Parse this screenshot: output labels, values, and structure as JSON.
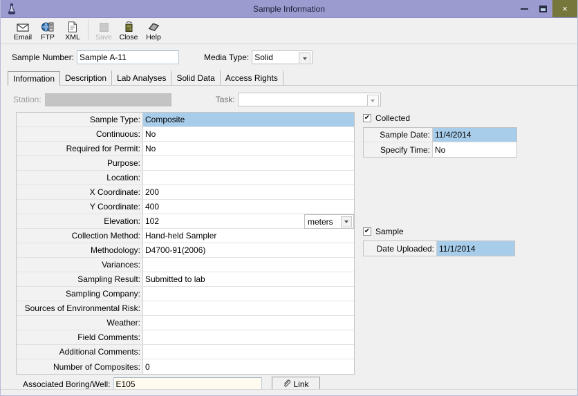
{
  "window": {
    "title": "Sample Information",
    "icon": "flask-icon",
    "buttons": {
      "minimize": "minimize-icon",
      "maximize": "maximize-icon",
      "close": "×"
    },
    "colors": {
      "titlebar": "#9c9bd0",
      "close_button": "#76773a",
      "selection": "#a8cdea",
      "surface": "#f0f0f0",
      "ivory_field": "#fffbee"
    }
  },
  "toolbar": {
    "items": [
      {
        "label": "Email",
        "icon": "envelope-icon",
        "disabled": false
      },
      {
        "label": "FTP",
        "icon": "ftp-globe-icon",
        "disabled": false
      },
      {
        "label": "XML",
        "icon": "xml-document-icon",
        "disabled": false
      },
      {
        "label": "Save",
        "icon": "save-disk-icon",
        "disabled": true
      },
      {
        "label": "Close",
        "icon": "door-close-icon",
        "disabled": false
      },
      {
        "label": "Help",
        "icon": "help-book-icon",
        "disabled": false
      }
    ]
  },
  "header": {
    "sample_number_label": "Sample Number:",
    "sample_number_value": "Sample A-11",
    "sample_number_placeholder": "",
    "media_type_label": "Media Type:",
    "media_type_value": "Solid"
  },
  "tabs": [
    {
      "label": "Information",
      "active": true
    },
    {
      "label": "Description",
      "active": false
    },
    {
      "label": "Lab Analyses",
      "active": false
    },
    {
      "label": "Solid Data",
      "active": false
    },
    {
      "label": "Access Rights",
      "active": false
    }
  ],
  "station_row": {
    "station_label": "Station:",
    "station_value": "",
    "station_disabled": true,
    "task_label": "Task:",
    "task_value": ""
  },
  "property_grid": {
    "rows": [
      {
        "name": "Sample Type:",
        "value": "Composite",
        "selected": true
      },
      {
        "name": "Continuous:",
        "value": "No",
        "selected": false
      },
      {
        "name": "Required for Permit:",
        "value": "No",
        "selected": false
      },
      {
        "name": "Purpose:",
        "value": "",
        "selected": false
      },
      {
        "name": "Location:",
        "value": "",
        "selected": false
      },
      {
        "name": "X Coordinate:",
        "value": "200",
        "selected": false
      },
      {
        "name": "Y Coordinate:",
        "value": "400",
        "selected": false
      },
      {
        "name": "Elevation:",
        "value": "102",
        "selected": false,
        "unit": "meters"
      },
      {
        "name": "Collection Method:",
        "value": "Hand-held Sampler",
        "selected": false
      },
      {
        "name": "Methodology:",
        "value": "D4700-91(2006)",
        "selected": false
      },
      {
        "name": "Variances:",
        "value": "",
        "selected": false
      },
      {
        "name": "Sampling Result:",
        "value": "Submitted to lab",
        "selected": false
      },
      {
        "name": "Sampling Company:",
        "value": "",
        "selected": false
      },
      {
        "name": "Sources of Environmental Risk:",
        "value": "",
        "selected": false
      },
      {
        "name": "Weather:",
        "value": "",
        "selected": false
      },
      {
        "name": "Field Comments:",
        "value": "",
        "selected": false
      },
      {
        "name": "Additional Comments:",
        "value": "",
        "selected": false
      },
      {
        "name": "Number of Composites:",
        "value": "0",
        "selected": false
      }
    ]
  },
  "right_panel": {
    "collected": {
      "checkbox_label": "Collected",
      "checked": true,
      "check_glyph": "✔",
      "rows": [
        {
          "name": "Sample Date:",
          "value": "11/4/2014",
          "highlight": true
        },
        {
          "name": "Specify Time:",
          "value": "No",
          "highlight": false
        }
      ]
    },
    "sample": {
      "checkbox_label": "Sample",
      "checked": true,
      "check_glyph": "✔",
      "rows": [
        {
          "name": "Date Uploaded:",
          "value": "11/1/2014",
          "highlight": true
        }
      ]
    }
  },
  "footer": {
    "associated_label": "Associated Boring/Well:",
    "associated_value": "E105",
    "link_button_label": "Link",
    "link_button_icon": "paperclip-icon"
  }
}
